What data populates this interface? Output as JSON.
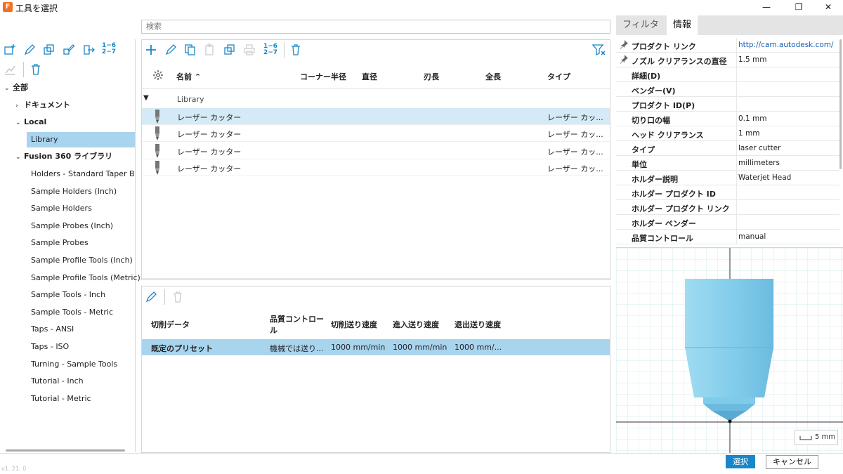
{
  "window": {
    "title": "工具を選択",
    "app_logo": "F",
    "controls": {
      "minimize": "—",
      "restore": "❐",
      "close": "✕"
    }
  },
  "search": {
    "placeholder": "検索"
  },
  "left_toolbar": {
    "icons": [
      "new-library-icon",
      "edit-icon",
      "duplicate-icon",
      "rename-icon",
      "export-icon",
      "renumber-icon",
      "chart-icon",
      "delete-icon"
    ],
    "renumber_label_top": "1−6",
    "renumber_label_bottom": "2−7"
  },
  "tree": {
    "root": "全部",
    "documents": "ドキュメント",
    "local": "Local",
    "library": "Library",
    "fusion": "Fusion 360 ライブラリ",
    "fusion_items": [
      "Holders - Standard Taper Blan",
      "Sample Holders (Inch)",
      "Sample Holders",
      "Sample Probes (Inch)",
      "Sample Probes",
      "Sample Profile Tools (Inch)",
      "Sample Profile Tools (Metric)",
      "Sample Tools - Inch",
      "Sample Tools - Metric",
      "Taps - ANSI",
      "Taps - ISO",
      "Turning - Sample Tools",
      "Tutorial - Inch",
      "Tutorial - Metric"
    ]
  },
  "tool_toolbar": {
    "renumber_top": "1−6",
    "renumber_bottom": "2−7"
  },
  "tool_table": {
    "columns": {
      "name": "名前 ⌃",
      "corner_radius": "コーナー半径",
      "diameter": "直径",
      "flute_length": "刃長",
      "overall_length": "全長",
      "type": "タイプ"
    },
    "group": "Library",
    "rows": [
      {
        "name": "レーザー カッター",
        "type": "レーザー カッ..."
      },
      {
        "name": "レーザー カッター",
        "type": "レーザー カッ..."
      },
      {
        "name": "レーザー カッター",
        "type": "レーザー カッ..."
      },
      {
        "name": "レーザー カッター",
        "type": "レーザー カッ..."
      }
    ]
  },
  "preset_table": {
    "columns": {
      "cut_data": "切削データ",
      "quality_line1": "品質コントロー",
      "quality_line2": "ル",
      "cutting_feed": "切削送り速度",
      "lead_in_feed": "進入送り速度",
      "lead_out_feed": "退出送り速度"
    },
    "row": {
      "name": "既定のプリセット",
      "quality": "機械では送り...",
      "cutting_feed": "1000 mm/min",
      "lead_in_feed": "1000 mm/min",
      "lead_out_feed": "1000 mm/..."
    }
  },
  "right_panel": {
    "tabs": {
      "filter": "フィルタ",
      "info": "情報"
    },
    "properties": [
      {
        "label": "プロダクト リンク",
        "value": "http://cam.autodesk.com/",
        "pinned": true,
        "link": true
      },
      {
        "label": "ノズル クリアランスの直径",
        "value": "1.5 mm",
        "pinned": true
      },
      {
        "label": "詳細(D)",
        "value": ""
      },
      {
        "label": "ベンダー(V)",
        "value": ""
      },
      {
        "label": "プロダクト ID(P)",
        "value": ""
      },
      {
        "label": "切り口の幅",
        "value": "0.1 mm"
      },
      {
        "label": "ヘッド クリアランス",
        "value": "1 mm"
      },
      {
        "label": "タイプ",
        "value": "laser cutter"
      },
      {
        "label": "単位",
        "value": "millimeters"
      },
      {
        "label": "ホルダー説明",
        "value": "Waterjet Head"
      },
      {
        "label": "ホルダー プロダクト ID",
        "value": ""
      },
      {
        "label": "ホルダー プロダクト リンク",
        "value": ""
      },
      {
        "label": "ホルダー ベンダー",
        "value": ""
      },
      {
        "label": "品質コントロール",
        "value": "manual"
      }
    ],
    "scale_label": "5 mm"
  },
  "footer": {
    "select": "選択",
    "cancel": "キャンセル",
    "version": "v1. 21. 0"
  },
  "colors": {
    "accent": "#1a86c8",
    "selection": "#a9d4ee",
    "tool_body": "#7fcbea"
  }
}
